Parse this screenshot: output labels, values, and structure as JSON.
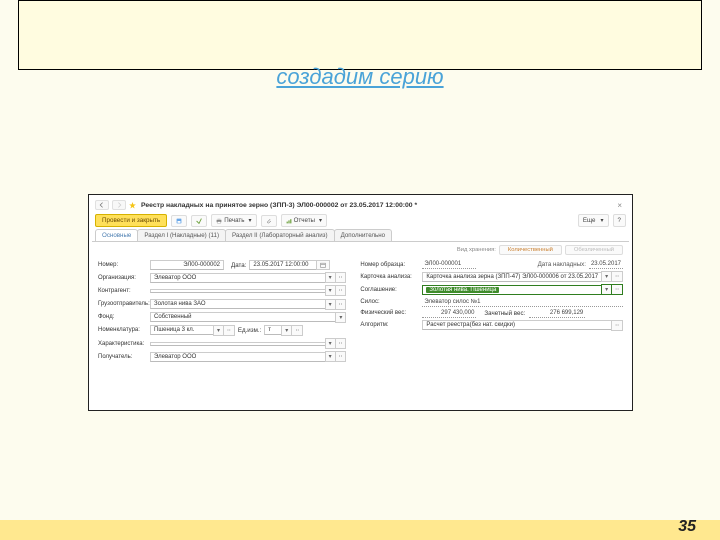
{
  "slide": {
    "subtitle": "создадим серию",
    "page_number": "35"
  },
  "window": {
    "title": "Реестр накладных на принятое зерно (ЗПП-3) ЭЛ00-000002 от 23.05.2017 12:00:00 *",
    "toolbar": {
      "primary": "Провести и закрыть",
      "save_tooltip": "Записать",
      "post_tooltip": "Провести",
      "print_label": "Печать",
      "attach_tooltip": "Присоединенные файлы",
      "reports_label": "Отчеты",
      "more_label": "Еще",
      "help_label": "?"
    },
    "tabs": [
      {
        "label": "Основные",
        "active": true
      },
      {
        "label": "Раздел I (Накладные) (11)",
        "active": false
      },
      {
        "label": "Раздел II (Лабораторный анализ)",
        "active": false
      },
      {
        "label": "Дополнительно",
        "active": false
      }
    ],
    "status": {
      "label": "Вид хранения:",
      "pill1": "Количественный",
      "pill2": "Обезличенный"
    },
    "left": {
      "number_label": "Номер:",
      "number_value": "ЭЛ00-000002",
      "date_label": "Дата:",
      "date_value": "23.05.2017 12:00:00",
      "org_label": "Организация:",
      "org_value": "Элеватор ООО",
      "counterparty_label": "Контрагент:",
      "counterparty_value": "",
      "shipper_label": "Грузоотправитель:",
      "shipper_value": "Золотая нива ЗАО",
      "fund_label": "Фонд:",
      "fund_value": "Собственный",
      "nomen_label": "Номенклатура:",
      "nomen_value": "Пшеница 3 кл.",
      "unit_label": "Ед.изм.:",
      "unit_value": "т",
      "char_label": "Характеристика:",
      "char_value": "",
      "recipient_label": "Получатель:",
      "recipient_value": "Элеватор ООО"
    },
    "right": {
      "sample_label": "Номер образца:",
      "sample_value": "ЭЛ00-000001",
      "invoice_date_label": "Дата накладных:",
      "invoice_date_value": "23.05.2017",
      "card_label": "Карточка анализа:",
      "card_value": "Карточка анализа зерна (ЗПП-47) ЭЛ00-000006 от 23.05.2017",
      "agree_label": "Соглашение:",
      "agree_value": "Золотая нива. Пшеница",
      "silo_label": "Силос:",
      "silo_value": "Элеватор силос №1",
      "phys_label": "Физический вес:",
      "phys_value": "297 430,000",
      "net_label": "Зачетный вес:",
      "net_value": "276 699,129",
      "algo_label": "Алгоритм:",
      "algo_value": "Расчет реестра(без нат. скидки)"
    }
  }
}
